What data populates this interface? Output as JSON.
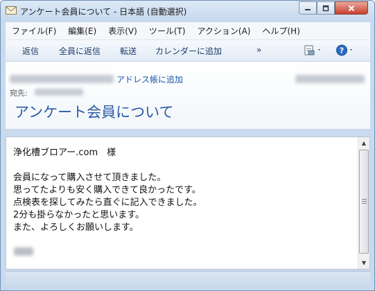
{
  "window": {
    "title": "アンケート会員について - 日本語 (自動選択)"
  },
  "menu": {
    "items": [
      {
        "id": "file",
        "label": "ファイル(F)"
      },
      {
        "id": "edit",
        "label": "編集(E)"
      },
      {
        "id": "view",
        "label": "表示(V)"
      },
      {
        "id": "tools",
        "label": "ツール(T)"
      },
      {
        "id": "actions",
        "label": "アクション(A)"
      },
      {
        "id": "help",
        "label": "ヘルプ(H)"
      }
    ]
  },
  "toolbar": {
    "reply": "返信",
    "reply_all": "全員に返信",
    "forward": "転送",
    "add_to_calendar": "カレンダーに追加",
    "more": "»"
  },
  "header": {
    "add_to_address_book": "アドレス帳に追加",
    "to_label": "宛先:",
    "subject": "アンケート会員について"
  },
  "body": {
    "lines": [
      "浄化槽ブロアー.com　様",
      "",
      "会員になって購入させて頂きました。",
      "思ってたよりも安く購入できて良かったです。",
      "点検表を探してみたら直ぐに記入できました。",
      "2分も掛らなかったと思います。",
      "また、よろしくお願いします。"
    ]
  },
  "colors": {
    "accent": "#2a5aa3",
    "link": "#1a55a8",
    "chrome": "#c9daee"
  }
}
